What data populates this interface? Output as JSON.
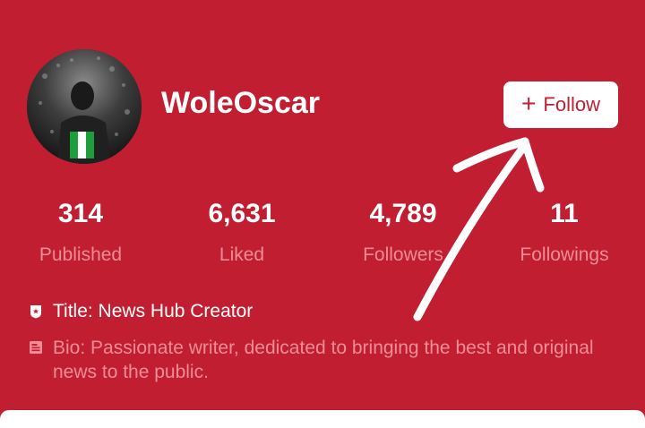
{
  "profile": {
    "username": "WoleOscar",
    "avatar": "profile-photo-avatar"
  },
  "follow_button": {
    "icon": "+",
    "label": "Follow"
  },
  "stats": [
    {
      "value": "314",
      "label": "Published"
    },
    {
      "value": "6,631",
      "label": "Liked"
    },
    {
      "value": "4,789",
      "label": "Followers"
    },
    {
      "value": "11",
      "label": "Followings"
    }
  ],
  "title_row": {
    "icon": "badge-icon",
    "text": "Title: News Hub Creator"
  },
  "bio_row": {
    "icon": "document-icon",
    "text": "Bio: Passionate writer, dedicated to bringing the best and original news to the public."
  },
  "colors": {
    "background": "#c21e31",
    "muted_text": "#ef8d97",
    "button_bg": "#ffffff"
  }
}
